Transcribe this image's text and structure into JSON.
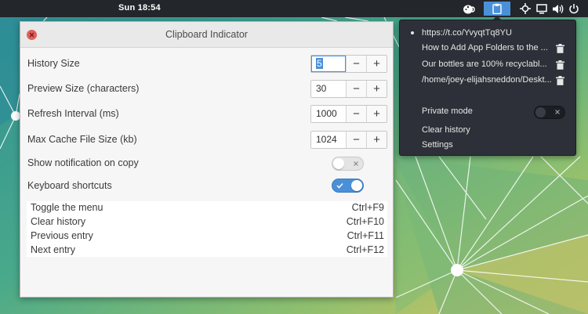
{
  "topbar": {
    "clock": "Sun 18:54"
  },
  "dialog": {
    "title": "Clipboard Indicator",
    "settings": [
      {
        "label": "History Size",
        "value": "5",
        "minus": "−",
        "plus": "+"
      },
      {
        "label": "Preview Size (characters)",
        "value": "30",
        "minus": "−",
        "plus": "+"
      },
      {
        "label": "Refresh Interval (ms)",
        "value": "1000",
        "minus": "−",
        "plus": "+"
      },
      {
        "label": "Max Cache File Size (kb)",
        "value": "1024",
        "minus": "−",
        "plus": "+"
      }
    ],
    "toggles": [
      {
        "label": "Show notification on copy",
        "state": "off"
      },
      {
        "label": "Keyboard shortcuts",
        "state": "on"
      }
    ],
    "shortcuts": [
      {
        "name": "Toggle the menu",
        "key": "Ctrl+F9"
      },
      {
        "name": "Clear history",
        "key": "Ctrl+F10"
      },
      {
        "name": "Previous entry",
        "key": "Ctrl+F11"
      },
      {
        "name": "Next entry",
        "key": "Ctrl+F12"
      }
    ]
  },
  "menu": {
    "history": [
      {
        "text": "https://t.co/YvyqtTq8YU",
        "current": true
      },
      {
        "text": "How to Add App Folders to the ...",
        "current": false
      },
      {
        "text": "Our bottles are 100% recyclabl...",
        "current": false
      },
      {
        "text": "/home/joey-elijahsneddon/Deskt...",
        "current": false
      }
    ],
    "private_mode": "Private mode",
    "clear_history": "Clear history",
    "settings": "Settings"
  },
  "colors": {
    "accent": "#4a90d9",
    "topbar": "#23262b",
    "menu_bg": "#2d3038",
    "close": "#e0605a"
  }
}
